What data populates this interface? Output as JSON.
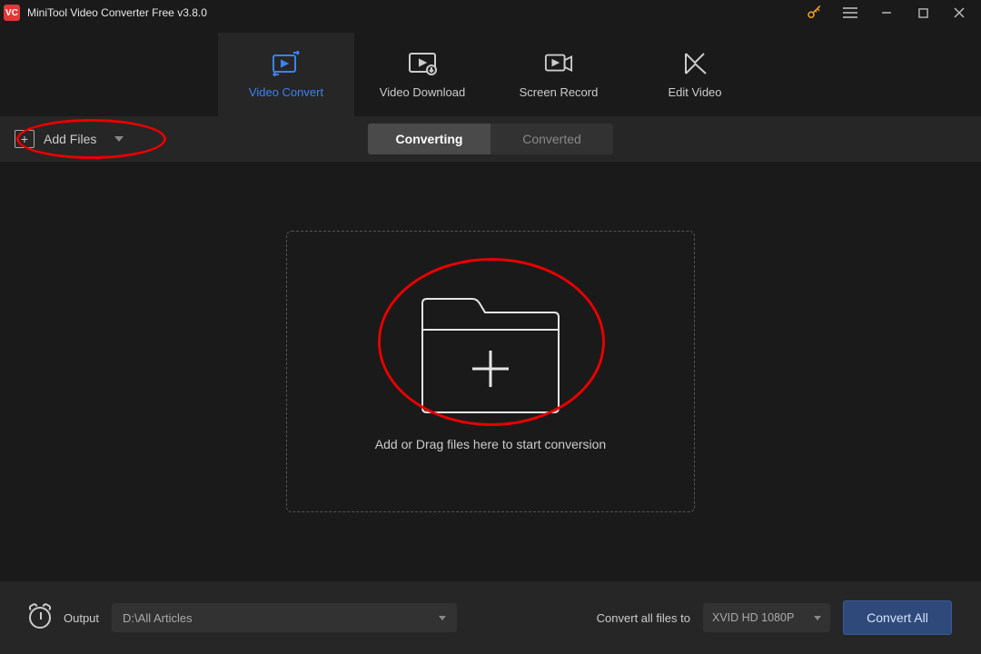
{
  "title": "MiniTool Video Converter Free v3.8.0",
  "nav": {
    "convert": "Video Convert",
    "download": "Video Download",
    "record": "Screen Record",
    "edit": "Edit Video"
  },
  "toolbar": {
    "add_files": "Add Files",
    "converting": "Converting",
    "converted": "Converted"
  },
  "dropzone": {
    "hint": "Add or Drag files here to start conversion"
  },
  "footer": {
    "output_label": "Output",
    "output_path": "D:\\All Articles",
    "convert_all_label": "Convert all files to",
    "format": "XVID HD 1080P",
    "convert_all_btn": "Convert All"
  }
}
